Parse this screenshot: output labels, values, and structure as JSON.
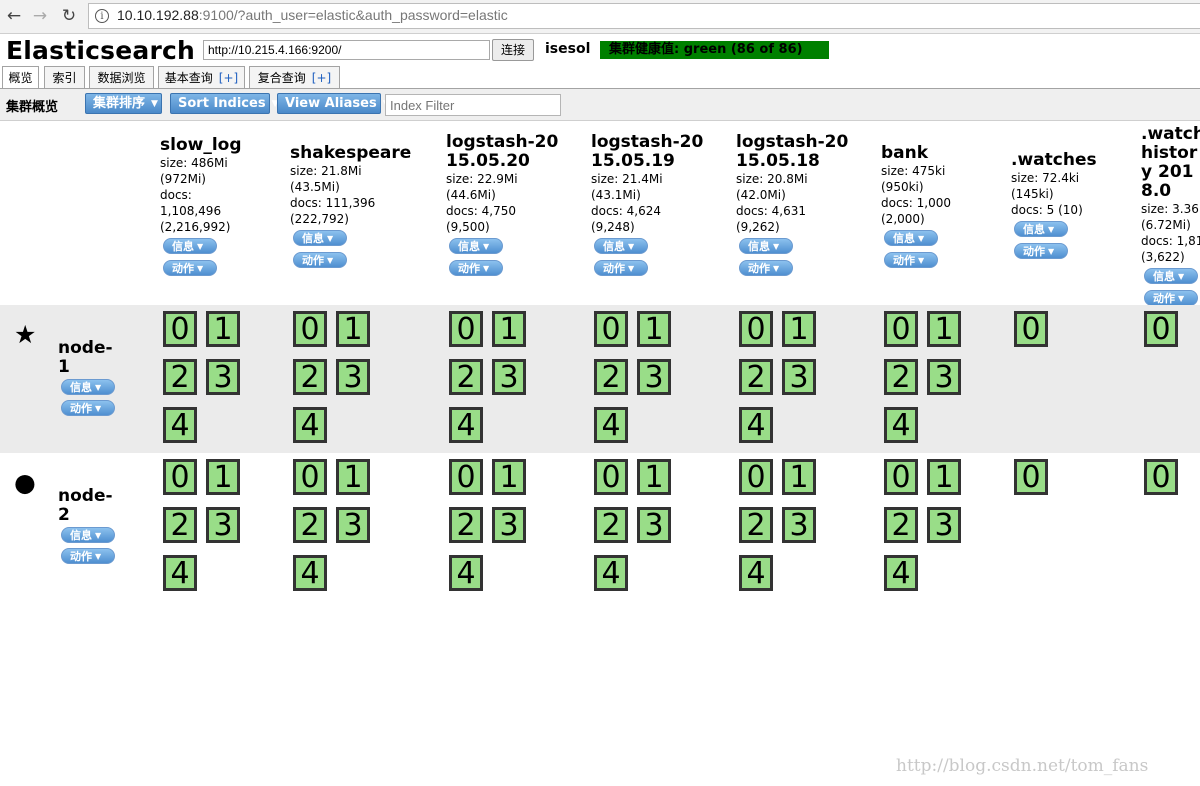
{
  "browser": {
    "url_host": "10.10.192.88",
    "url_rest": ":9100/?auth_user=elastic&auth_password=elastic"
  },
  "header": {
    "brand": "Elasticsearch",
    "connect_url": "http://10.215.4.166:9200/",
    "connect_button": "连接",
    "cluster_name": "isesol",
    "health": "集群健康值: green (86 of 86)",
    "health_color": "#008000"
  },
  "tabs": [
    {
      "label": "概览",
      "plus": ""
    },
    {
      "label": "索引",
      "plus": ""
    },
    {
      "label": "数据浏览",
      "plus": ""
    },
    {
      "label": "基本查询",
      "plus": "[+]"
    },
    {
      "label": "复合查询",
      "plus": "[+]"
    }
  ],
  "toolbar": {
    "title": "集群概览",
    "sort_cluster": "集群排序",
    "sort_indices": "Sort Indices",
    "view_aliases": "View Aliases",
    "filter_placeholder": "Index Filter"
  },
  "pill_labels": {
    "info": "信息",
    "action": "动作"
  },
  "indices": [
    {
      "name": "slow_log",
      "stats": [
        "size: 486Mi",
        "(972Mi)",
        "docs:",
        "1,108,496",
        "(2,216,992)"
      ],
      "shards": [
        "0",
        "1",
        "2",
        "3",
        "4"
      ]
    },
    {
      "name": "shakespeare",
      "stats": [
        "size: 21.8Mi",
        "(43.5Mi)",
        "docs: 111,396",
        "(222,792)"
      ],
      "shards": [
        "0",
        "1",
        "2",
        "3",
        "4"
      ]
    },
    {
      "name": "logstash-2015.05.20",
      "stats": [
        "size: 22.9Mi",
        "(44.6Mi)",
        "docs: 4,750",
        "(9,500)"
      ],
      "shards": [
        "0",
        "1",
        "2",
        "3",
        "4"
      ]
    },
    {
      "name": "logstash-2015.05.19",
      "stats": [
        "size: 21.4Mi",
        "(43.1Mi)",
        "docs: 4,624",
        "(9,248)"
      ],
      "shards": [
        "0",
        "1",
        "2",
        "3",
        "4"
      ]
    },
    {
      "name": "logstash-2015.05.18",
      "stats": [
        "size: 20.8Mi",
        "(42.0Mi)",
        "docs: 4,631",
        "(9,262)"
      ],
      "shards": [
        "0",
        "1",
        "2",
        "3",
        "4"
      ]
    },
    {
      "name": "bank",
      "stats": [
        "size: 475ki",
        "(950ki)",
        "docs: 1,000",
        "(2,000)"
      ],
      "shards": [
        "0",
        "1",
        "2",
        "3",
        "4"
      ]
    },
    {
      "name": ".watches",
      "stats": [
        "size: 72.4ki",
        "(145ki)",
        "docs: 5 (10)"
      ],
      "shards": [
        "0"
      ]
    },
    {
      "name": ".watch history 2018.0",
      "stats": [
        "size: 3.36",
        "(6.72Mi)",
        "docs: 1,81",
        "(3,622)"
      ],
      "shards": [
        "0"
      ]
    }
  ],
  "nodes": [
    {
      "name": "node-1",
      "icon": "star-icon",
      "symbol": "★"
    },
    {
      "name": "node-2",
      "icon": "circle-icon",
      "symbol": "●"
    }
  ],
  "watermark": "http://blog.csdn.net/tom_fans"
}
